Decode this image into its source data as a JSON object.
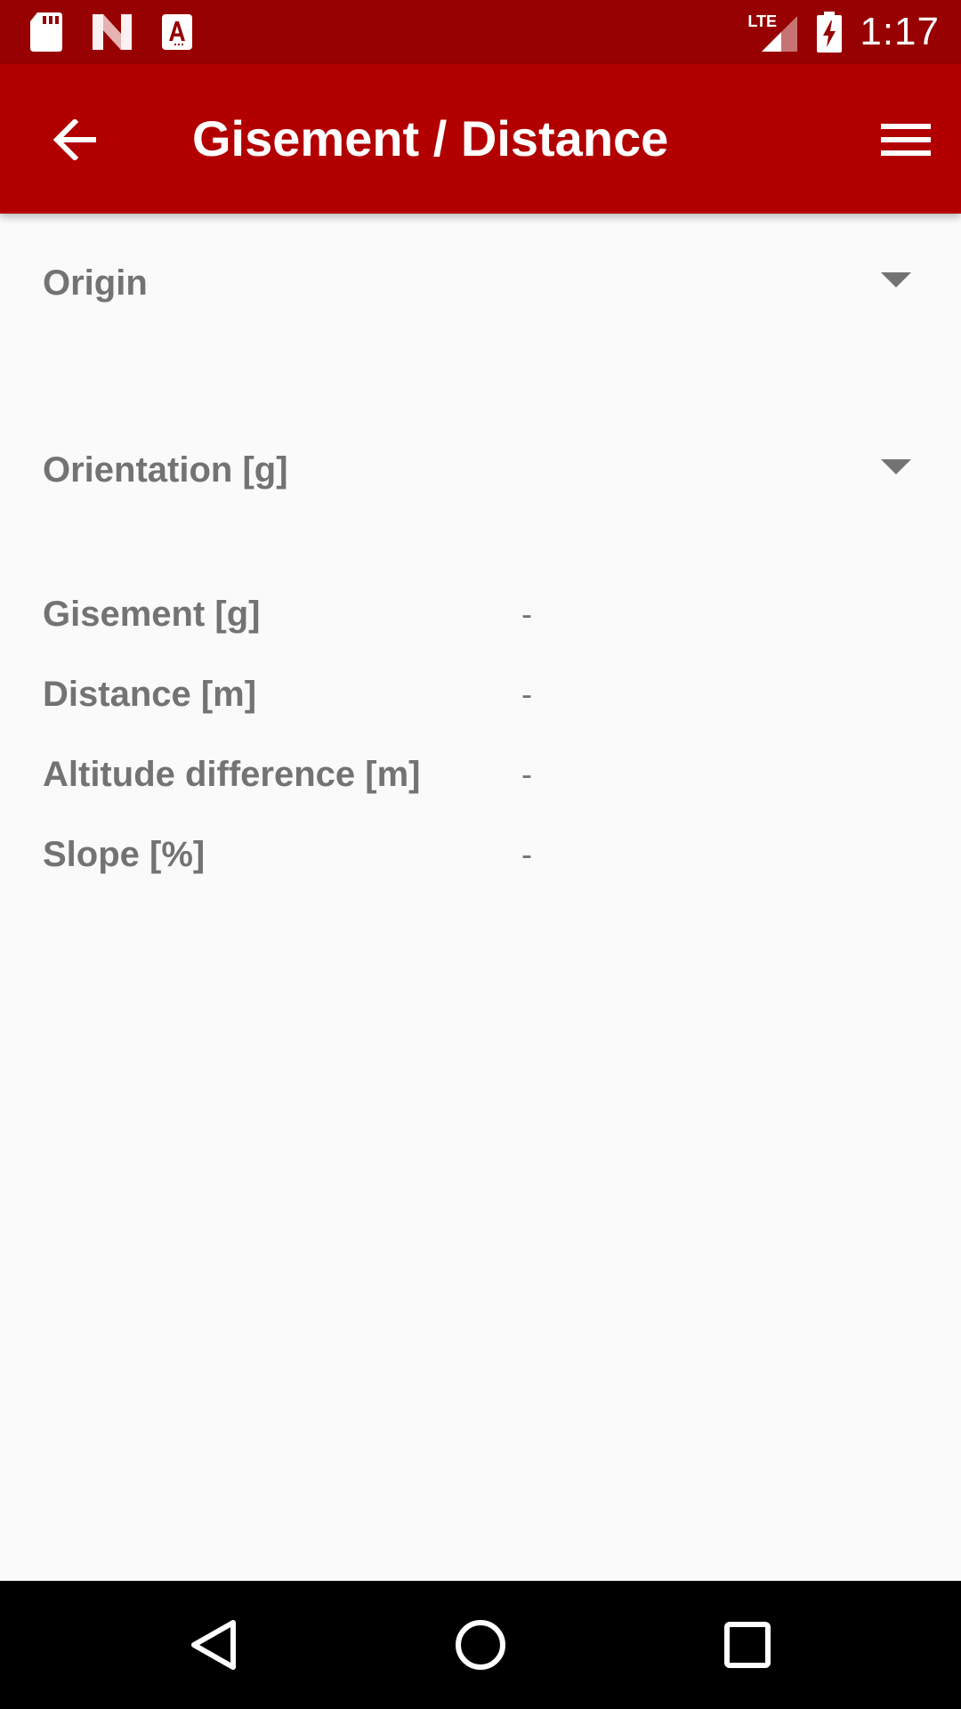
{
  "status_bar": {
    "time": "1:17",
    "network": "LTE",
    "icons": [
      "sd-card-icon",
      "n-logo-icon",
      "a-app-icon",
      "signal-icon",
      "battery-charging-icon"
    ]
  },
  "app_bar": {
    "title": "Gisement / Distance",
    "back_icon": "arrow-back-icon",
    "menu_icon": "hamburger-menu-icon"
  },
  "form": {
    "origin_label": "Origin",
    "orientation_label": "Orientation [g]"
  },
  "results": [
    {
      "label": "Gisement [g]",
      "value": "-"
    },
    {
      "label": "Distance [m]",
      "value": "-"
    },
    {
      "label": "Altitude difference [m]",
      "value": "-"
    },
    {
      "label": "Slope [%]",
      "value": "-"
    }
  ],
  "nav_bar": {
    "buttons": [
      "back-triangle-icon",
      "home-circle-icon",
      "recents-square-icon"
    ]
  },
  "colors": {
    "status_bar": "#970101",
    "app_bar": "#b20000",
    "background": "#fafafa",
    "label_text": "#737373"
  }
}
